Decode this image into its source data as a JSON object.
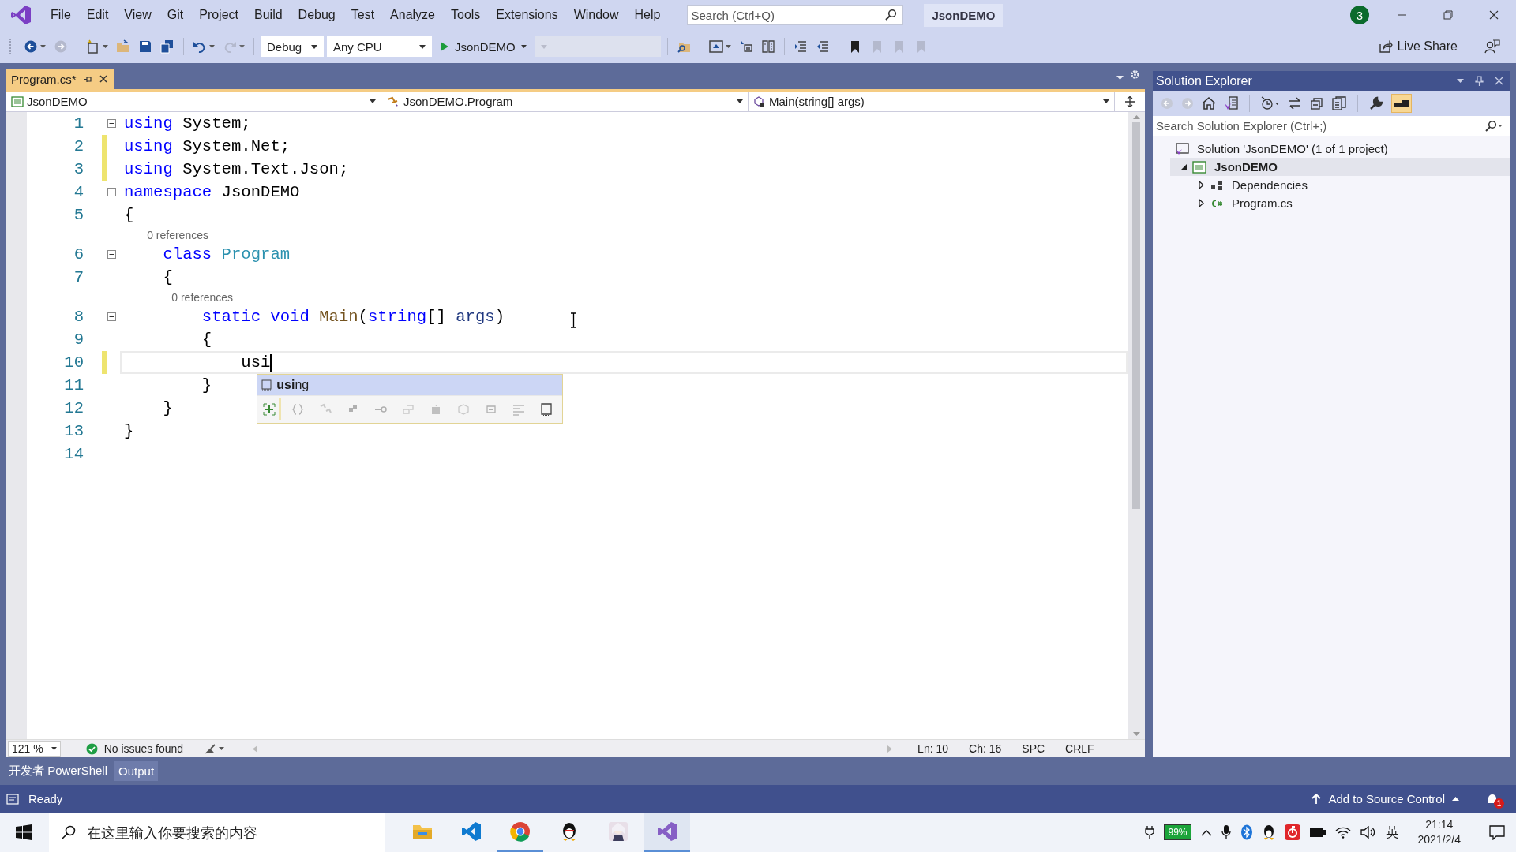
{
  "menu_bar": {
    "items": [
      "File",
      "Edit",
      "View",
      "Git",
      "Project",
      "Build",
      "Debug",
      "Test",
      "Analyze",
      "Tools",
      "Extensions",
      "Window",
      "Help"
    ],
    "search": {
      "placeholder": "Search (Ctrl+Q)"
    },
    "solution_name": "JsonDEMO",
    "notifications_count": "3"
  },
  "toolbar": {
    "items": [
      {
        "kind": "back",
        "disabled": false
      },
      {
        "kind": "forward",
        "disabled": true
      },
      {
        "kind": "separator"
      },
      {
        "kind": "new",
        "disabled": false
      },
      {
        "kind": "open",
        "disabled": false
      },
      {
        "kind": "save",
        "disabled": false
      },
      {
        "kind": "save-all",
        "disabled": false
      },
      {
        "kind": "separator"
      },
      {
        "kind": "undo",
        "disabled": false
      },
      {
        "kind": "redo",
        "disabled": true
      },
      {
        "kind": "separator"
      },
      {
        "kind": "dropdown",
        "value": "Debug",
        "disabled": false
      },
      {
        "kind": "dropdown",
        "value": "Any CPU",
        "disabled": false
      },
      {
        "kind": "start",
        "label": "JsonDEMO"
      },
      {
        "kind": "dropdown",
        "disabled": true
      },
      {
        "kind": "separator"
      },
      {
        "kind": "find",
        "disabled": false
      },
      {
        "kind": "separator"
      },
      {
        "kind": "browser",
        "disabled": false
      },
      {
        "kind": "step",
        "disabled": false
      },
      {
        "kind": "panes",
        "disabled": false
      },
      {
        "kind": "separator"
      },
      {
        "kind": "indent",
        "disabled": false
      },
      {
        "kind": "outdent",
        "disabled": false
      },
      {
        "kind": "separator"
      },
      {
        "kind": "bookmark",
        "disabled": false
      },
      {
        "kind": "bookmark",
        "disabled": true
      },
      {
        "kind": "bookmark",
        "disabled": true
      },
      {
        "kind": "bookmark",
        "disabled": true
      }
    ],
    "live_share": "Live Share"
  },
  "editor": {
    "tabs": [
      {
        "label": "Program.cs*",
        "selected": true
      }
    ],
    "navigation": {
      "project": "JsonDEMO",
      "type": "JsonDEMO.Program",
      "member": "Main(string[] args)"
    },
    "lines": [
      {
        "number": "1",
        "changed": false,
        "collapsible": true,
        "current": false,
        "segments": [
          {
            "kind": "keyword",
            "text": "using"
          },
          {
            "kind": "plain",
            "text": " System;"
          }
        ]
      },
      {
        "number": "2",
        "changed": true,
        "collapsible": false,
        "current": false,
        "segments": [
          {
            "kind": "keyword",
            "text": "using"
          },
          {
            "kind": "plain",
            "text": " System.Net;"
          }
        ]
      },
      {
        "number": "3",
        "changed": true,
        "collapsible": false,
        "current": false,
        "segments": [
          {
            "kind": "keyword",
            "text": "using"
          },
          {
            "kind": "plain",
            "text": " System.Text.Json;"
          }
        ]
      },
      {
        "number": "4",
        "changed": false,
        "collapsible": true,
        "current": false,
        "segments": [
          {
            "kind": "keyword",
            "text": "namespace"
          },
          {
            "kind": "plain",
            "text": " JsonDEMO"
          }
        ]
      },
      {
        "number": "5",
        "changed": false,
        "collapsible": false,
        "current": false,
        "segments": [
          {
            "kind": "plain",
            "text": "{"
          }
        ]
      },
      {
        "number": "6",
        "changed": false,
        "collapsible": true,
        "current": false,
        "codelens": "0 references",
        "segments": [
          {
            "kind": "keyword",
            "text": "    class"
          },
          {
            "kind": "type",
            "text": " Program"
          }
        ]
      },
      {
        "number": "7",
        "changed": false,
        "collapsible": false,
        "current": false,
        "segments": [
          {
            "kind": "plain",
            "text": "    {"
          }
        ]
      },
      {
        "number": "8",
        "changed": false,
        "collapsible": true,
        "current": false,
        "codelens": "0 references",
        "segments": [
          {
            "kind": "keyword",
            "text": "        static void"
          },
          {
            "kind": "method",
            "text": " Main"
          },
          {
            "kind": "plain",
            "text": "("
          },
          {
            "kind": "keyword",
            "text": "string"
          },
          {
            "kind": "plain",
            "text": "[] "
          },
          {
            "kind": "param",
            "text": "args"
          },
          {
            "kind": "plain",
            "text": ")"
          }
        ]
      },
      {
        "number": "9",
        "changed": false,
        "collapsible": false,
        "current": false,
        "segments": [
          {
            "kind": "plain",
            "text": "        {"
          }
        ]
      },
      {
        "number": "10",
        "changed": true,
        "collapsible": false,
        "current": true,
        "segments": [
          {
            "kind": "plain",
            "text": "            usi"
          }
        ]
      },
      {
        "number": "11",
        "changed": false,
        "collapsible": false,
        "current": false,
        "segments": [
          {
            "kind": "plain",
            "text": "        }"
          }
        ]
      },
      {
        "number": "12",
        "changed": false,
        "collapsible": false,
        "current": false,
        "segments": [
          {
            "kind": "plain",
            "text": "    }"
          }
        ]
      },
      {
        "number": "13",
        "changed": false,
        "collapsible": false,
        "current": false,
        "segments": [
          {
            "kind": "plain",
            "text": "}"
          }
        ]
      },
      {
        "number": "14",
        "changed": false,
        "collapsible": false,
        "current": false
      }
    ],
    "completion": {
      "items": [
        {
          "label": "**usi**ng",
          "selected": true
        }
      ],
      "filters": [
        {
          "kind": "expand",
          "selected": true
        },
        {
          "kind": "namespace",
          "selected": false
        },
        {
          "kind": "class",
          "selected": false
        },
        {
          "kind": "struct",
          "selected": false
        },
        {
          "kind": "interface",
          "selected": false
        },
        {
          "kind": "enum",
          "selected": false
        },
        {
          "kind": "module",
          "selected": false
        },
        {
          "kind": "field",
          "selected": false
        },
        {
          "kind": "constant",
          "selected": false
        },
        {
          "kind": "text",
          "selected": false
        },
        {
          "kind": "snippet",
          "selected": false
        }
      ]
    },
    "status": {
      "zoom": "121 %",
      "issues": "No issues found",
      "line": "Ln: 10",
      "column": "Ch: 16",
      "whitespace": "SPC",
      "line_endings": "CRLF"
    }
  },
  "solution_explorer": {
    "title": "Solution Explorer",
    "search": {
      "placeholder": "Search Solution Explorer (Ctrl+;)"
    },
    "tree": [
      {
        "label": "Solution 'JsonDEMO' (1 of 1 project)",
        "kind": "solution",
        "selected": false,
        "children": [
          {
            "label": "JsonDEMO",
            "kind": "project",
            "selected": true,
            "expanded": true,
            "startup": true,
            "children": [
              {
                "label": "Dependencies",
                "kind": "dependencies",
                "selected": false,
                "expanded": false,
                "startup": false
              },
              {
                "label": "Program.cs",
                "kind": "csharp",
                "selected": false,
                "expanded": false,
                "startup": false
              }
            ]
          }
        ]
      }
    ]
  },
  "tool_tabs": [
    {
      "label": "开发者 PowerShell",
      "selected": false
    },
    {
      "label": "Output",
      "selected": true
    }
  ],
  "status_bar": {
    "state": "Ready",
    "source_control": "Add to Source Control",
    "notifications": "1"
  },
  "taskbar": {
    "search": {
      "placeholder": "在这里输入你要搜索的内容"
    },
    "apps": [
      {
        "kind": "folder",
        "running": false,
        "selected": false
      },
      {
        "kind": "vscode",
        "running": false,
        "selected": false
      },
      {
        "kind": "chrome",
        "running": true,
        "selected": false
      },
      {
        "kind": "penguin",
        "running": false,
        "selected": false
      },
      {
        "kind": "character",
        "running": false,
        "selected": false
      },
      {
        "kind": "visualstudio",
        "running": true,
        "selected": true
      }
    ],
    "battery": "99%",
    "input_method": "英",
    "time": "21:14",
    "date": "2021/2/4"
  }
}
